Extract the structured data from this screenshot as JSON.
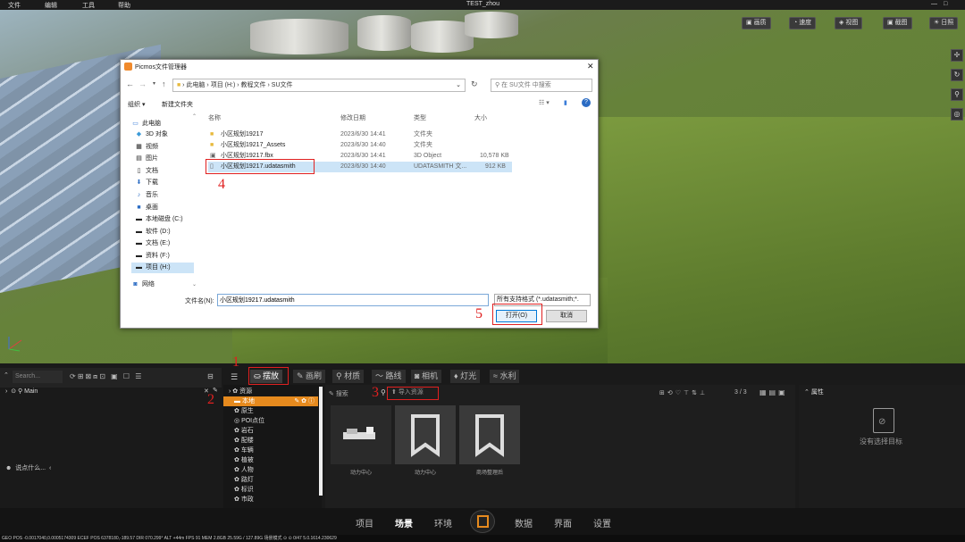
{
  "menubar": {
    "items": [
      "文件",
      "编辑",
      "工具",
      "帮助"
    ],
    "window_title": "TEST_zhou"
  },
  "viewport_toolbar": {
    "buttons": [
      "画质",
      "速度",
      "视图",
      "截图",
      "日照"
    ]
  },
  "dialog": {
    "title": "Picmos文件管理器",
    "breadcrumb": [
      "此电脑",
      "项目 (H:)",
      "教程文件",
      "SU文件"
    ],
    "search_placeholder": "在 SU文件 中搜索",
    "organize": "组织 ▾",
    "new_folder": "新建文件夹",
    "nav_items": [
      "此电脑",
      "3D 对象",
      "视频",
      "图片",
      "文档",
      "下载",
      "音乐",
      "桌面",
      "本地磁盘 (C:)",
      "软件 (D:)",
      "文档 (E:)",
      "资料 (F:)",
      "项目 (H:)",
      "网络"
    ],
    "columns": {
      "name": "名称",
      "date": "修改日期",
      "type": "类型",
      "size": "大小"
    },
    "files": [
      {
        "name": "小区规划19217",
        "date": "2023/6/30 14:41",
        "type": "文件夹",
        "size": ""
      },
      {
        "name": "小区规划19217_Assets",
        "date": "2023/6/30 14:40",
        "type": "文件夹",
        "size": ""
      },
      {
        "name": "小区规划19217.fbx",
        "date": "2023/6/30 14:41",
        "type": "3D Object",
        "size": "10,578 KB"
      },
      {
        "name": "小区规划19217.udatasmith",
        "date": "2023/6/30 14:40",
        "type": "UDATASMITH 文...",
        "size": "912 KB"
      }
    ],
    "filename_label": "文件名(N):",
    "filename_value": "小区规划19217.udatasmith",
    "filter_value": "所有支持格式 (*.udatasmith;*.",
    "open_button": "打开(O)",
    "cancel_button": "取消"
  },
  "annotations": [
    "1",
    "2",
    "3",
    "4",
    "5"
  ],
  "left_panel": {
    "search_placeholder": "Search...",
    "tree_item": "Main",
    "chat_hint": "说点什么..."
  },
  "tabs": [
    "摆放",
    "画刷",
    "材质",
    "路线",
    "相机",
    "灯光",
    "水利"
  ],
  "asset_tree": {
    "root": "资源",
    "items": [
      "本地",
      "原生",
      "POI点位",
      "岩石",
      "配楼",
      "车辆",
      "植被",
      "人物",
      "路灯",
      "标识",
      "市政"
    ]
  },
  "asset_browser": {
    "search_placeholder": "搜索",
    "import_button": "导入资源",
    "page_count": "3 / 3",
    "assets": [
      "动力中心",
      "动力中心",
      "商场整理后"
    ]
  },
  "properties": {
    "title": "属性",
    "empty_text": "没有选择目标"
  },
  "bottom_nav": [
    "项目",
    "场景",
    "环境",
    "数据",
    "界面",
    "设置"
  ],
  "status": "GEO POS  -0.0017040,0.0005174309    ECEF POS  6378180,-189.57    DIR  070.299°   ALT  +44m    FPS  91    MEM  2.8GB  25.59G / 127.89G            场景模式 ⊙   ⊙ 0/47    5.0.1614.230629"
}
